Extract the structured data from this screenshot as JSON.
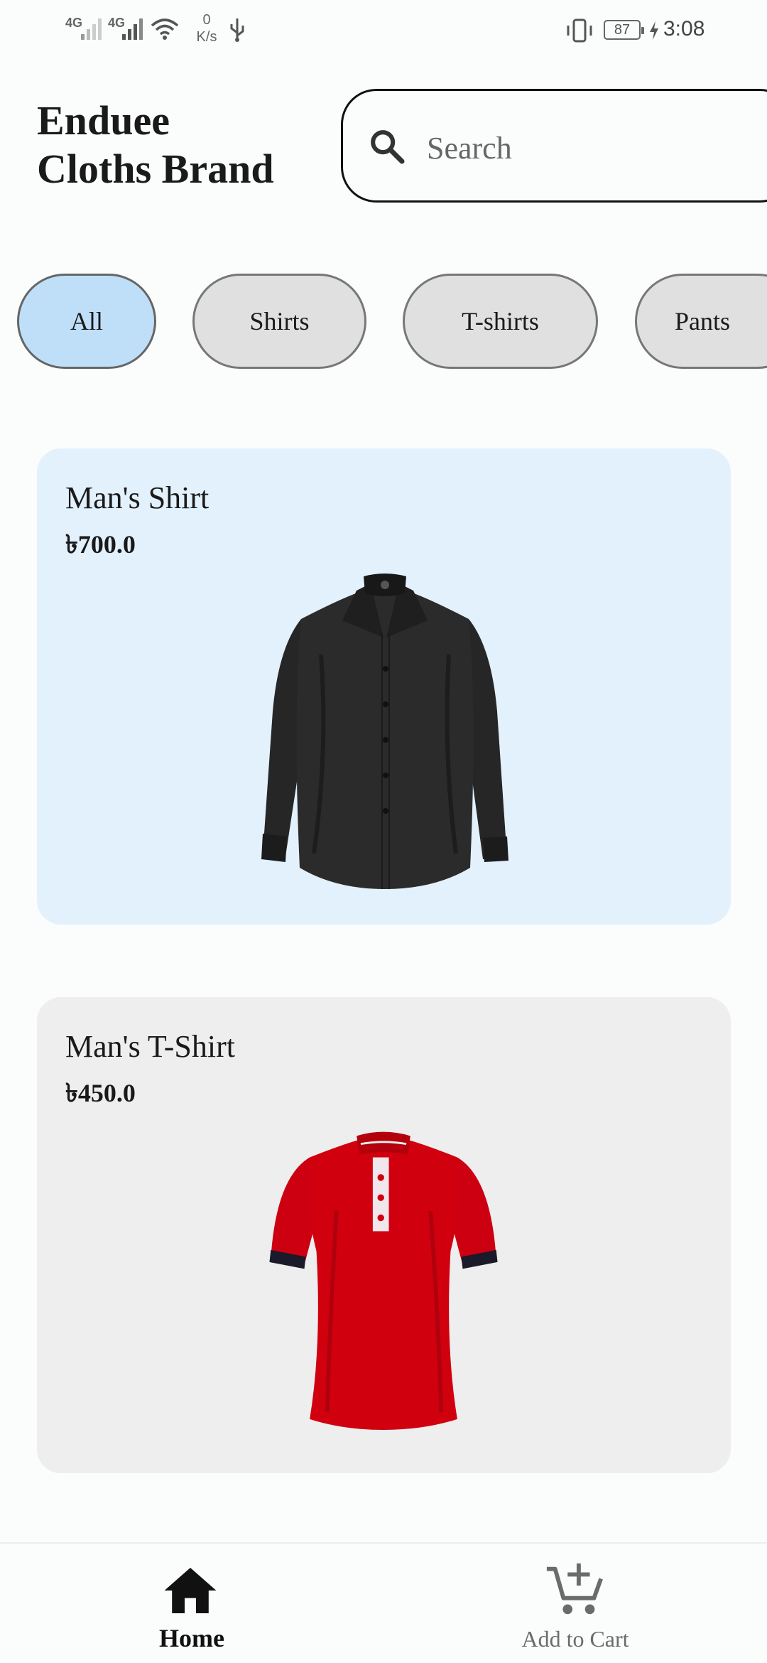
{
  "status_bar": {
    "net1": "4G",
    "net2": "4G",
    "speed_value": "0",
    "speed_unit": "K/s",
    "battery": "87",
    "time": "3:08"
  },
  "header": {
    "title_line1": "Enduee",
    "title_line2": "Cloths Brand"
  },
  "search": {
    "placeholder": "Search",
    "icon": "search-icon"
  },
  "categories": [
    {
      "label": "All",
      "selected": true
    },
    {
      "label": "Shirts",
      "selected": false
    },
    {
      "label": "T-shirts",
      "selected": false
    },
    {
      "label": "Pants",
      "selected": false
    }
  ],
  "products": [
    {
      "name": "Man's Shirt",
      "price": "৳700.0",
      "image": "black-shirt-image",
      "card_color": "#e3f1fd"
    },
    {
      "name": "Man's T-Shirt",
      "price": "৳450.0",
      "image": "red-polo-image",
      "card_color": "#eeeeee"
    }
  ],
  "bottom_nav": {
    "home_label": "Home",
    "cart_label": "Add to Cart",
    "active": "Home"
  },
  "colors": {
    "accent_chip": "#bfdff9",
    "chip": "#e0e0e0",
    "shirt": "#262626",
    "tshirt": "#d00012"
  }
}
